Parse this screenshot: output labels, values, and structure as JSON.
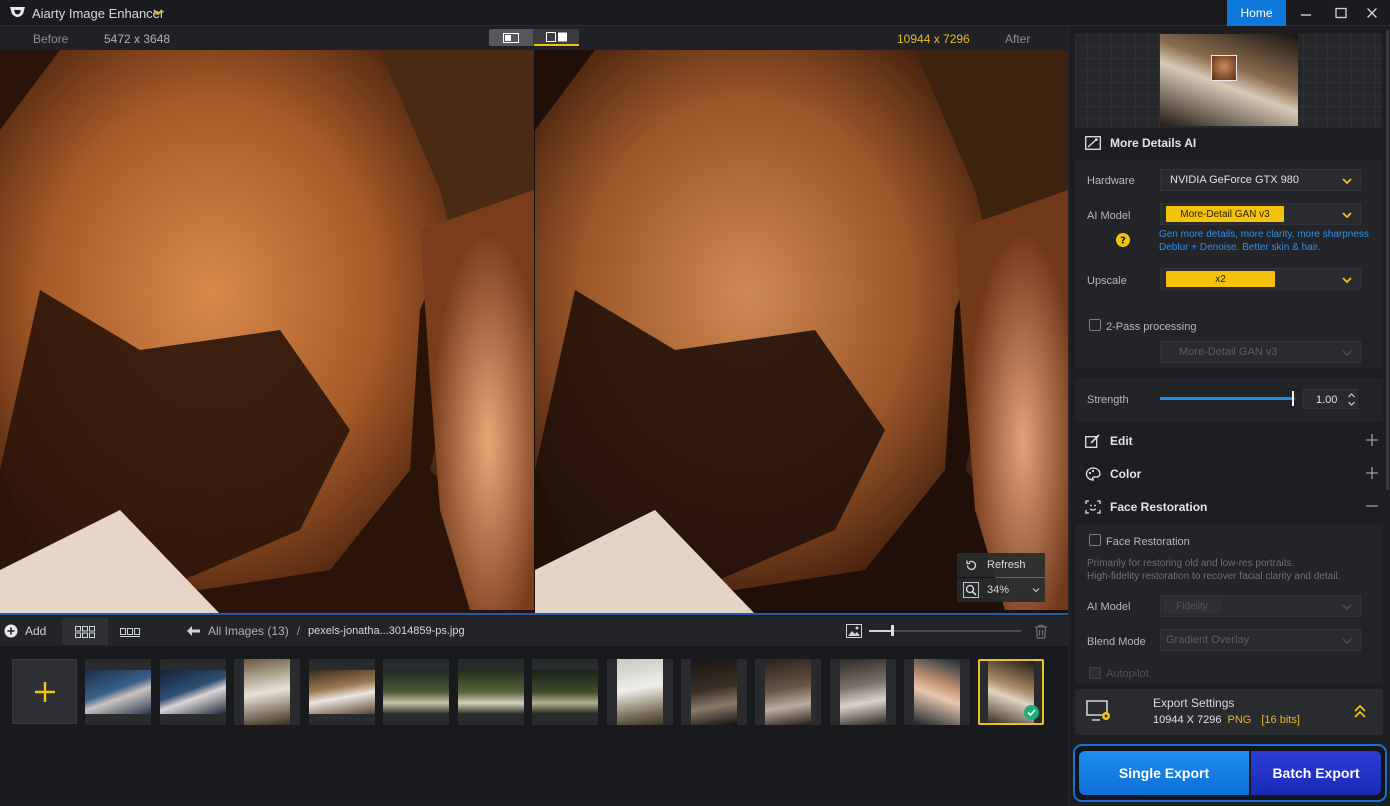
{
  "app": {
    "title": "Aiarty Image Enhancer",
    "home_label": "Home",
    "accent": "#0e78d8",
    "highlight": "#f3c20c"
  },
  "compare": {
    "before_label": "Before",
    "before_size": "5472 x 3648",
    "after_size": "10944 x 7296",
    "after_label": "After"
  },
  "view_controls": {
    "refresh_label": "Refresh",
    "zoom_value": "34%"
  },
  "toolbar": {
    "add_label": "Add",
    "breadcrumb_all": "All Images (13)",
    "breadcrumb_sep": "/",
    "breadcrumb_file": "pexels-jonatha...3014859-ps.jpg"
  },
  "panel": {
    "section_more_details": "More Details AI",
    "hardware_label": "Hardware",
    "hardware_value": "NVIDIA GeForce GTX 980",
    "ai_model_label": "AI Model",
    "ai_model_value": "More-Detail GAN  v3",
    "ai_model_hint_line1": "Gen more details, more clarity, more sharpness",
    "ai_model_hint_line2": "Deblur + Denoise. Better skin & hair.",
    "upscale_label": "Upscale",
    "upscale_value": "x2",
    "two_pass_label": "2-Pass processing",
    "two_pass_model": "More-Detail GAN  v3",
    "strength_label": "Strength",
    "strength_value": "1.00",
    "strength_fraction": 0.98,
    "section_edit": "Edit",
    "section_color": "Color",
    "section_face": "Face Restoration",
    "face_check_label": "Face Restoration",
    "face_hint_line1": "Primarily for restoring old and low-res portraits.",
    "face_hint_line2": "High-fidelity restoration to recover facial clarity and detail.",
    "face_ai_model_label": "AI Model",
    "face_ai_model_value": "Fidelity",
    "blend_mode_label": "Blend Mode",
    "blend_mode_value": "Gradient Overlay",
    "autopilot_label": "Autopilot"
  },
  "export": {
    "settings_title": "Export Settings",
    "resolution": "10944 X 7296",
    "format": "PNG",
    "bit_depth": "[16 bits]",
    "single_label": "Single Export",
    "batch_label": "Batch Export"
  }
}
